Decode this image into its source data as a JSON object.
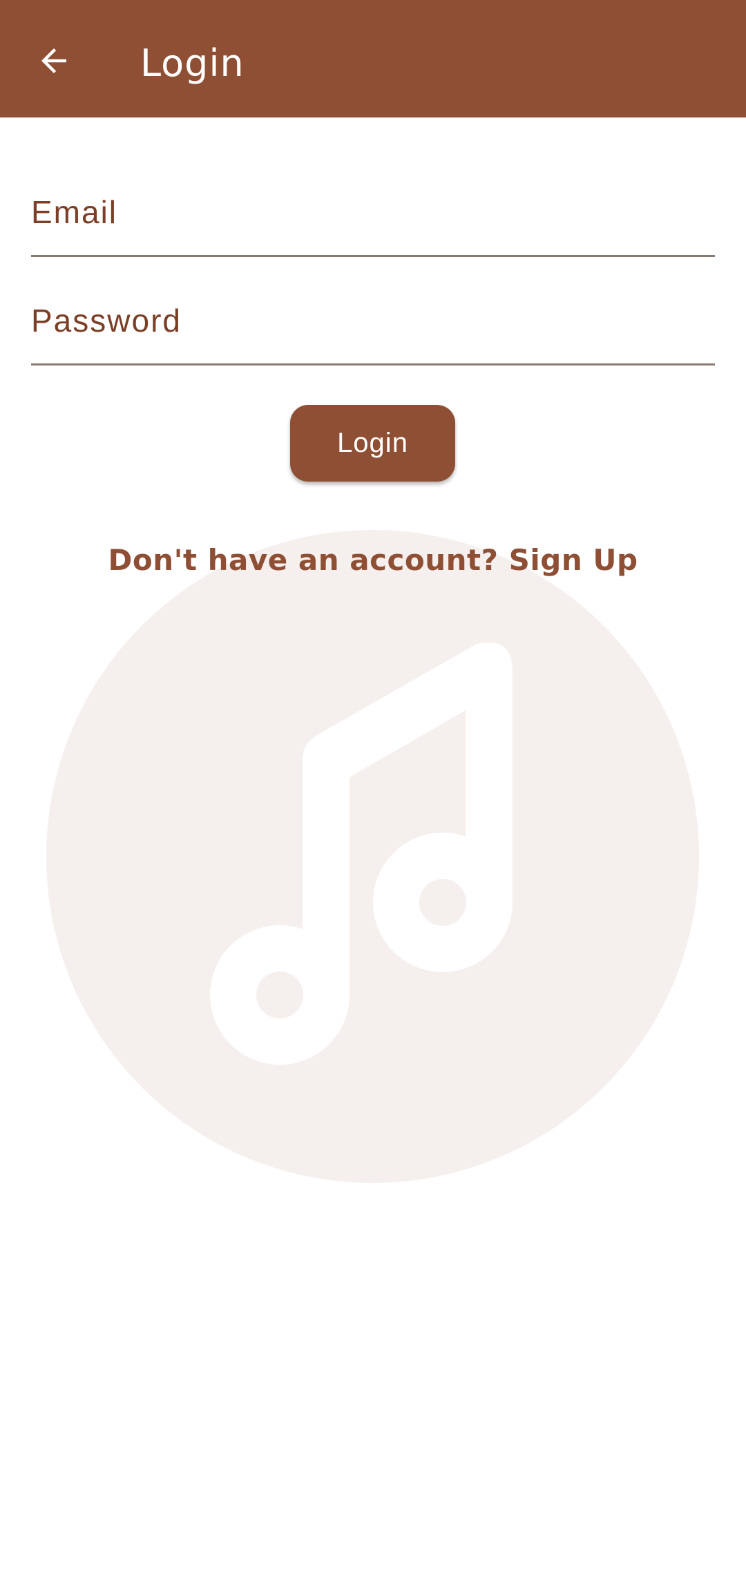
{
  "app_bar": {
    "title": "Login",
    "back_icon": "arrow-left-icon",
    "background": "#8e4f34"
  },
  "form": {
    "email_placeholder": "Email",
    "email_value": "",
    "password_placeholder": "Password",
    "password_value": "",
    "login_label": "Login"
  },
  "signup_link": "Don't have an account? Sign Up",
  "logo": {
    "icon": "music-note-icon"
  },
  "colors": {
    "accent": "#8e4f34",
    "text_brown": "#7a3f26",
    "logo_circle": "#f5efed"
  }
}
